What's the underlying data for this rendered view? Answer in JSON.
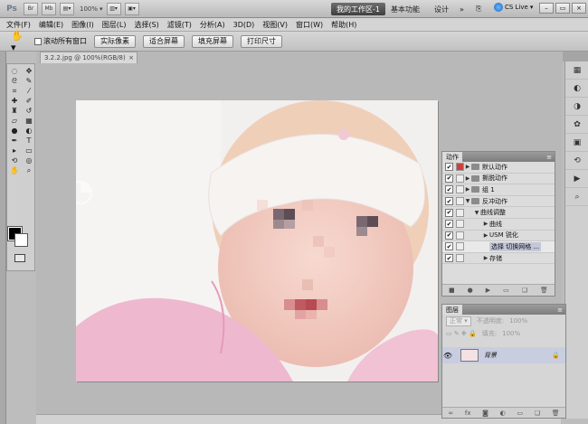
{
  "appbar": {
    "logo": "Ps",
    "btn_br": "Br",
    "btn_mb": "Mb",
    "zoom": "100%",
    "workspace_active": "我的工作区-1",
    "workspace_basic": "基本功能",
    "workspace_design": "设计",
    "workspace_more": "»",
    "cslive": "CS Live"
  },
  "menubar": {
    "items": [
      "文件(F)",
      "编辑(E)",
      "图像(I)",
      "图层(L)",
      "选择(S)",
      "滤镜(T)",
      "分析(A)",
      "3D(D)",
      "视图(V)",
      "窗口(W)",
      "帮助(H)"
    ]
  },
  "options": {
    "scroll_all_label": "滚动所有窗口",
    "btn_actual": "实际像素",
    "btn_fit": "适合屏幕",
    "btn_fill": "填充屏幕",
    "btn_print": "打印尺寸"
  },
  "document": {
    "tab_title": "3.2.2.jpg @ 100%(RGB/8)",
    "tab_close": "×"
  },
  "actions_panel": {
    "tab": "动作",
    "menu": "≡",
    "rows": [
      {
        "label": "默认动作",
        "level": 0,
        "expanded": false,
        "folder": true,
        "dialog": true
      },
      {
        "label": "撕脱动作",
        "level": 0,
        "expanded": false,
        "folder": true,
        "dialog": false
      },
      {
        "label": "组 1",
        "level": 0,
        "expanded": false,
        "folder": true,
        "dialog": false
      },
      {
        "label": "反冲动作",
        "level": 0,
        "expanded": true,
        "folder": true,
        "dialog": false
      },
      {
        "label": "曲线调整",
        "level": 1,
        "expanded": true,
        "folder": false,
        "dialog": false
      },
      {
        "label": "曲线",
        "level": 2,
        "expanded": false,
        "folder": false,
        "dialog": false
      },
      {
        "label": "USM 锐化",
        "level": 2,
        "expanded": false,
        "folder": false,
        "dialog": false
      },
      {
        "label": "选择 切换网格 ...",
        "level": 2,
        "expanded": null,
        "folder": false,
        "dialog": false,
        "highlight": true
      },
      {
        "label": "存储",
        "level": 2,
        "expanded": false,
        "folder": false,
        "dialog": false
      }
    ]
  },
  "layers_panel": {
    "tab": "图层",
    "blend_mode": "正常",
    "opacity_label": "不透明度:",
    "opacity": "100%",
    "fill_label": "填充:",
    "fill": "100%",
    "layer_name": "背景"
  }
}
